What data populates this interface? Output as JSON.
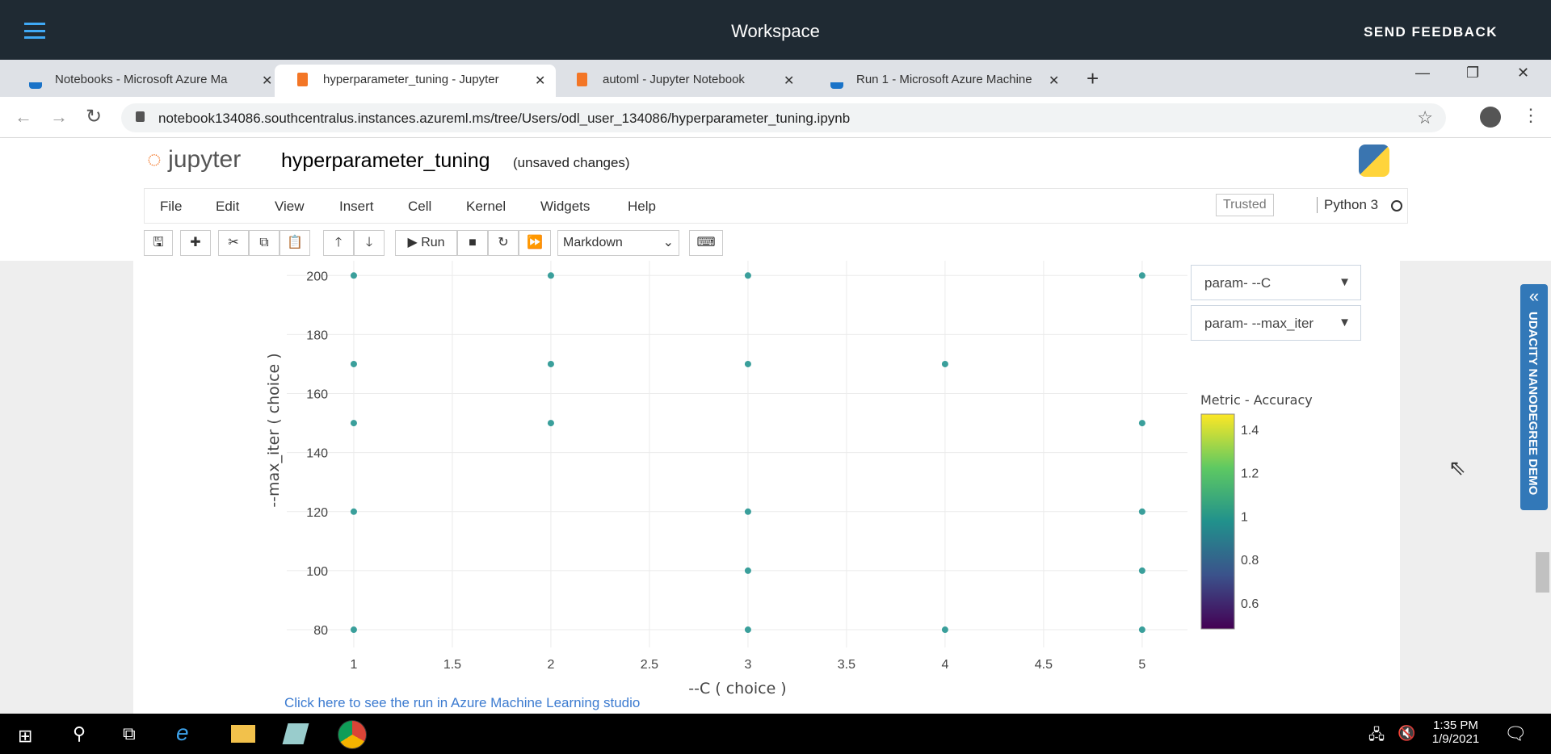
{
  "app": {
    "title": "Workspace",
    "feedback": "SEND FEEDBACK"
  },
  "tabs": [
    {
      "label": "Notebooks - Microsoft Azure Ma",
      "icon": "azure-flask-icon",
      "active": false
    },
    {
      "label": "hyperparameter_tuning - Jupyter",
      "icon": "jupyter-book-icon",
      "active": true
    },
    {
      "label": "automl - Jupyter Notebook",
      "icon": "jupyter-book-icon",
      "active": false
    },
    {
      "label": "Run 1 - Microsoft Azure Machine",
      "icon": "azure-flask-icon",
      "active": false
    }
  ],
  "browser": {
    "url": "notebook134086.southcentralus.instances.azureml.ms/tree/Users/odl_user_134086/hyperparameter_tuning.ipynb"
  },
  "jupyter": {
    "logo": "jupyter",
    "notebook_name": "hyperparameter_tuning",
    "status": "(unsaved changes)",
    "menu": [
      "File",
      "Edit",
      "View",
      "Insert",
      "Cell",
      "Kernel",
      "Widgets",
      "Help"
    ],
    "trusted": "Trusted",
    "kernel": "Python 3",
    "run_label": "Run",
    "cell_type": "Markdown"
  },
  "widgets": {
    "dropdown1": "param- --C",
    "dropdown2": "param- --max_iter"
  },
  "side_tab": "UDACITY NANODEGREE DEMO",
  "link": "Click here to see the run in Azure Machine Learning studio",
  "taskbar": {
    "time": "1:35 PM",
    "date": "1/9/2021"
  },
  "chart_data": {
    "type": "scatter",
    "xlabel": "--C ( choice )",
    "ylabel": "--max_iter ( choice )",
    "xlim": [
      0.66,
      5.23
    ],
    "ylim": [
      74,
      205
    ],
    "xticks": [
      1,
      1.5,
      2,
      2.5,
      3,
      3.5,
      4,
      4.5,
      5
    ],
    "xtick_labels": [
      "1",
      "1.5",
      "2",
      "2.5",
      "3",
      "3.5",
      "4",
      "4.5",
      "5"
    ],
    "yticks": [
      80,
      100,
      120,
      140,
      160,
      180,
      200
    ],
    "ytick_labels": [
      "80",
      "100",
      "120",
      "140",
      "160",
      "180",
      "200"
    ],
    "grid": true,
    "points": [
      {
        "x": 1,
        "y": 200
      },
      {
        "x": 1,
        "y": 170
      },
      {
        "x": 1,
        "y": 150
      },
      {
        "x": 1,
        "y": 120
      },
      {
        "x": 1,
        "y": 80
      },
      {
        "x": 2,
        "y": 200
      },
      {
        "x": 2,
        "y": 170
      },
      {
        "x": 2,
        "y": 150
      },
      {
        "x": 3,
        "y": 200
      },
      {
        "x": 3,
        "y": 170
      },
      {
        "x": 3,
        "y": 120
      },
      {
        "x": 3,
        "y": 100
      },
      {
        "x": 3,
        "y": 80
      },
      {
        "x": 4,
        "y": 170
      },
      {
        "x": 4,
        "y": 80
      },
      {
        "x": 5,
        "y": 200
      },
      {
        "x": 5,
        "y": 150
      },
      {
        "x": 5,
        "y": 120
      },
      {
        "x": 5,
        "y": 100
      },
      {
        "x": 5,
        "y": 80
      }
    ],
    "marker_color": "#3a9f9b",
    "colorbar": {
      "title": "Metric - Accuracy",
      "range": [
        0.48,
        1.47
      ],
      "ticks": [
        1.4,
        1.2,
        1,
        0.8,
        0.6
      ],
      "tick_labels": [
        "1.4",
        "1.2",
        "1",
        "0.8",
        "0.6"
      ],
      "colorscale": "viridis"
    }
  }
}
